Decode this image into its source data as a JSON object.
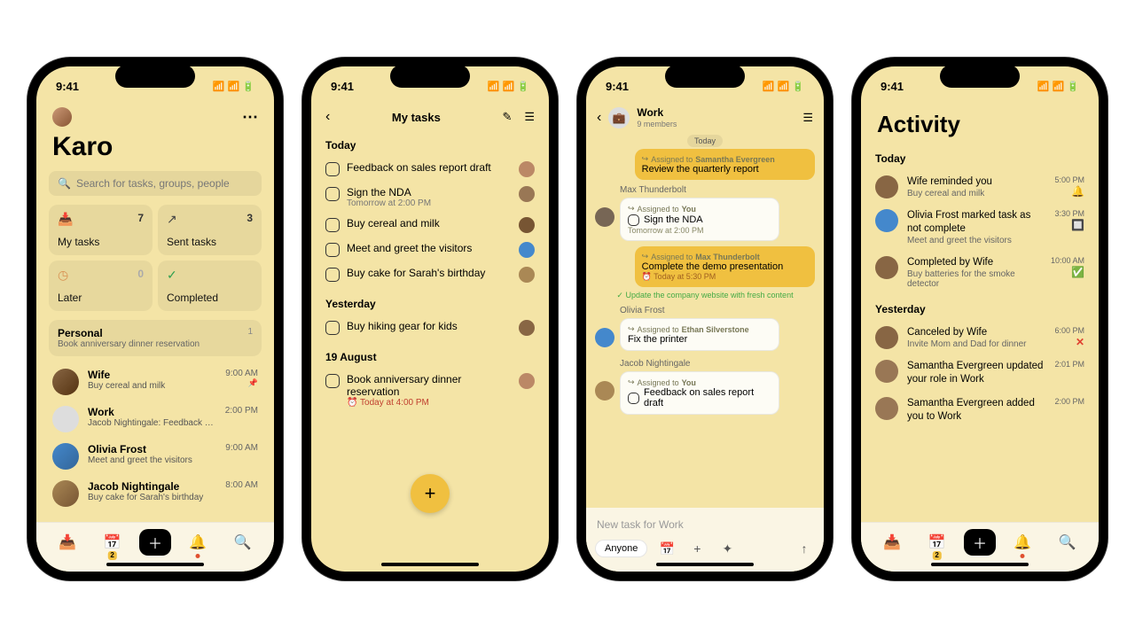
{
  "status_time": "9:41",
  "screen1": {
    "app_name": "Karo",
    "search_placeholder": "Search for tasks, groups, people",
    "tiles": [
      {
        "label": "My tasks",
        "count": "7"
      },
      {
        "label": "Sent tasks",
        "count": "3"
      },
      {
        "label": "Later",
        "count": "0"
      },
      {
        "label": "Completed",
        "count": ""
      }
    ],
    "personal": {
      "title": "Personal",
      "sub": "Book anniversary dinner reservation",
      "count": "1"
    },
    "convos": [
      {
        "name": "Wife",
        "sub": "Buy cereal and milk",
        "time": "9:00 AM",
        "pinned": true
      },
      {
        "name": "Work",
        "sub": "Jacob Nightingale: Feedback on sales rep...",
        "time": "2:00 PM"
      },
      {
        "name": "Olivia Frost",
        "sub": "Meet and greet the visitors",
        "time": "9:00 AM"
      },
      {
        "name": "Jacob Nightingale",
        "sub": "Buy cake for Sarah's birthday",
        "time": "8:00 AM"
      }
    ],
    "tab_badge": "2"
  },
  "screen2": {
    "title": "My tasks",
    "sections": [
      {
        "head": "Today",
        "tasks": [
          {
            "title": "Feedback on sales report draft"
          },
          {
            "title": "Sign the NDA",
            "sub": "Tomorrow at 2:00 PM"
          },
          {
            "title": "Buy cereal and milk"
          },
          {
            "title": "Meet and greet the visitors"
          },
          {
            "title": "Buy cake for Sarah's birthday"
          }
        ]
      },
      {
        "head": "Yesterday",
        "tasks": [
          {
            "title": "Buy hiking gear for kids"
          }
        ]
      },
      {
        "head": "19 August",
        "tasks": [
          {
            "title": "Book anniversary dinner reservation",
            "sub": "⏰ Today at 4:00 PM",
            "due": true
          }
        ]
      }
    ]
  },
  "screen3": {
    "title": "Work",
    "subtitle": "9 members",
    "day": "Today",
    "msg1": {
      "assigned": "Assigned to",
      "who": "Samantha Evergreen",
      "title": "Review the quarterly report"
    },
    "sender1": "Max Thunderbolt",
    "msg2": {
      "assigned": "Assigned to",
      "who": "You",
      "title": "Sign the NDA",
      "sub": "Tomorrow at 2:00 PM"
    },
    "msg3": {
      "assigned": "Assigned to",
      "who": "Max Thunderbolt",
      "title": "Complete the demo presentation",
      "sub": "⏰ Today at 5:30 PM"
    },
    "sys": "✓ Update the company website with fresh content",
    "sender2": "Olivia Frost",
    "msg4": {
      "assigned": "Assigned to",
      "who": "Ethan Silverstone",
      "title": "Fix the printer"
    },
    "sender3": "Jacob Nightingale",
    "msg5": {
      "assigned": "Assigned to",
      "who": "You",
      "title": "Feedback on sales report draft"
    },
    "composer_placeholder": "New task for Work",
    "chip": "Anyone"
  },
  "screen4": {
    "title": "Activity",
    "sections": [
      {
        "head": "Today",
        "items": [
          {
            "title": "Wife reminded you",
            "sub": "Buy cereal and milk",
            "time": "5:00 PM",
            "badge": "bell"
          },
          {
            "title": "Olivia Frost marked task as not complete",
            "sub": "Meet and greet the visitors",
            "time": "3:30 PM",
            "badge": "blue"
          },
          {
            "title": "Completed by Wife",
            "sub": "Buy batteries for the smoke detector",
            "time": "10:00 AM",
            "badge": "green"
          }
        ]
      },
      {
        "head": "Yesterday",
        "items": [
          {
            "title": "Canceled by Wife",
            "sub": "Invite Mom and Dad for dinner",
            "time": "6:00 PM",
            "badge": "red"
          },
          {
            "title": "Samantha Evergreen updated your role in Work",
            "sub": "",
            "time": "2:01 PM"
          },
          {
            "title": "Samantha Evergreen added you to Work",
            "sub": "",
            "time": "2:00 PM"
          }
        ]
      }
    ],
    "tab_badge": "2"
  }
}
